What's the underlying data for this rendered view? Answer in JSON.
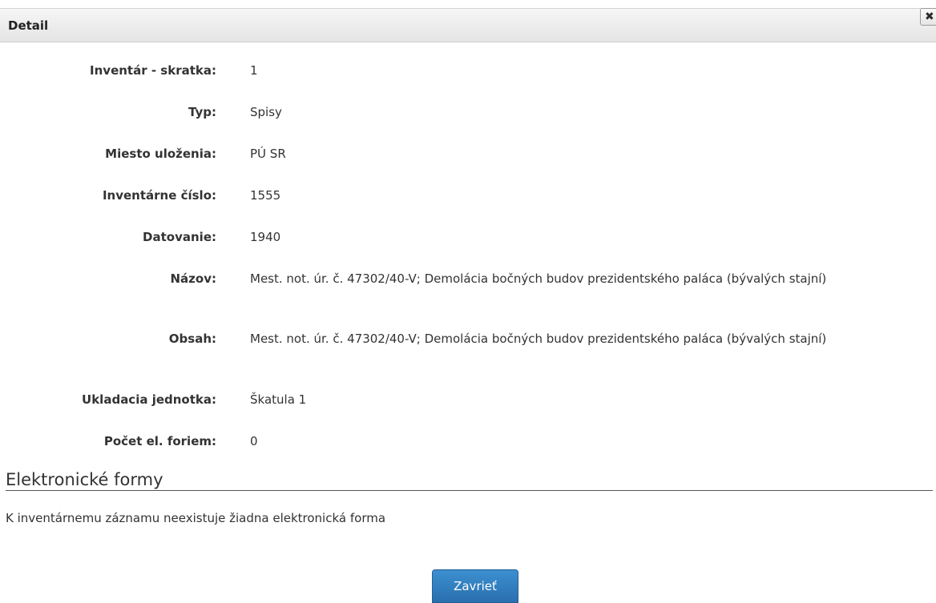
{
  "dialog": {
    "title": "Detail",
    "close_icon": "close-icon",
    "close_glyph": "✖"
  },
  "fields": [
    {
      "label": "Inventár - skratka:",
      "value": "1"
    },
    {
      "label": "Typ:",
      "value": "Spisy"
    },
    {
      "label": "Miesto uloženia:",
      "value": "PÚ SR"
    },
    {
      "label": "Inventárne číslo:",
      "value": "1555"
    },
    {
      "label": "Datovanie:",
      "value": "1940"
    },
    {
      "label": "Názov:",
      "value": "Mest. not. úr. č. 47302/40-V; Demolácia bočných budov prezidentského paláca (bývalých stajní)"
    },
    {
      "label": "Obsah:",
      "value": "Mest. not. úr. č. 47302/40-V; Demolácia bočných budov prezidentského paláca (bývalých stajní)"
    },
    {
      "label": "Ukladacia jednotka:",
      "value": "Škatula 1"
    },
    {
      "label": "Počet el. foriem:",
      "value": "0"
    }
  ],
  "electronic_forms": {
    "heading": "Elektronické formy",
    "empty_message": "K inventárnemu záznamu neexistuje žiadna elektronická forma"
  },
  "footer": {
    "close_label": "Zavrieť"
  },
  "colors": {
    "primary_button": "#337ab7",
    "title_bar": "#e8e8e8",
    "text": "#333333"
  }
}
